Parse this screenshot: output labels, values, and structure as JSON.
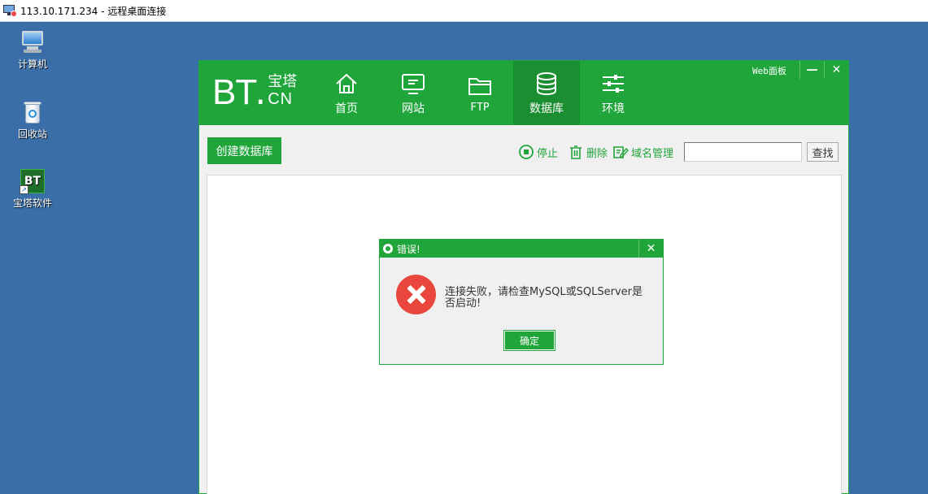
{
  "rdp": {
    "title": "113.10.171.234 - 远程桌面连接"
  },
  "desktop": {
    "icons": [
      {
        "label": "计算机"
      },
      {
        "label": "回收站"
      },
      {
        "label": "宝塔软件"
      }
    ]
  },
  "bt_window": {
    "logo": {
      "main": "BT",
      "dot": ".",
      "zh": "宝塔",
      "cn": "CN"
    },
    "web_panel": "Web面板",
    "controls": {
      "minimize": "—",
      "close": "✕"
    },
    "nav": [
      {
        "label": "首页",
        "icon": "home-icon"
      },
      {
        "label": "网站",
        "icon": "monitor-icon"
      },
      {
        "label": "FTP",
        "icon": "folder-icon"
      },
      {
        "label": "数据库",
        "icon": "database-icon",
        "active": true
      },
      {
        "label": "环境",
        "icon": "sliders-icon"
      }
    ],
    "toolbar": {
      "create_label": "创建数据库",
      "stop_label": "停止",
      "delete_label": "删除",
      "domain_label": "域名管理",
      "search_value": "",
      "search_button": "查找"
    }
  },
  "dialog": {
    "title": "错误!",
    "close": "✕",
    "message": "连接失败，请检查MySQL或SQLServer是否启动!",
    "ok_label": "确定"
  },
  "colors": {
    "brand": "#20a53a",
    "nav_active": "#1a8e31",
    "error": "#e9463e",
    "desktop": "#3a6ea8"
  }
}
